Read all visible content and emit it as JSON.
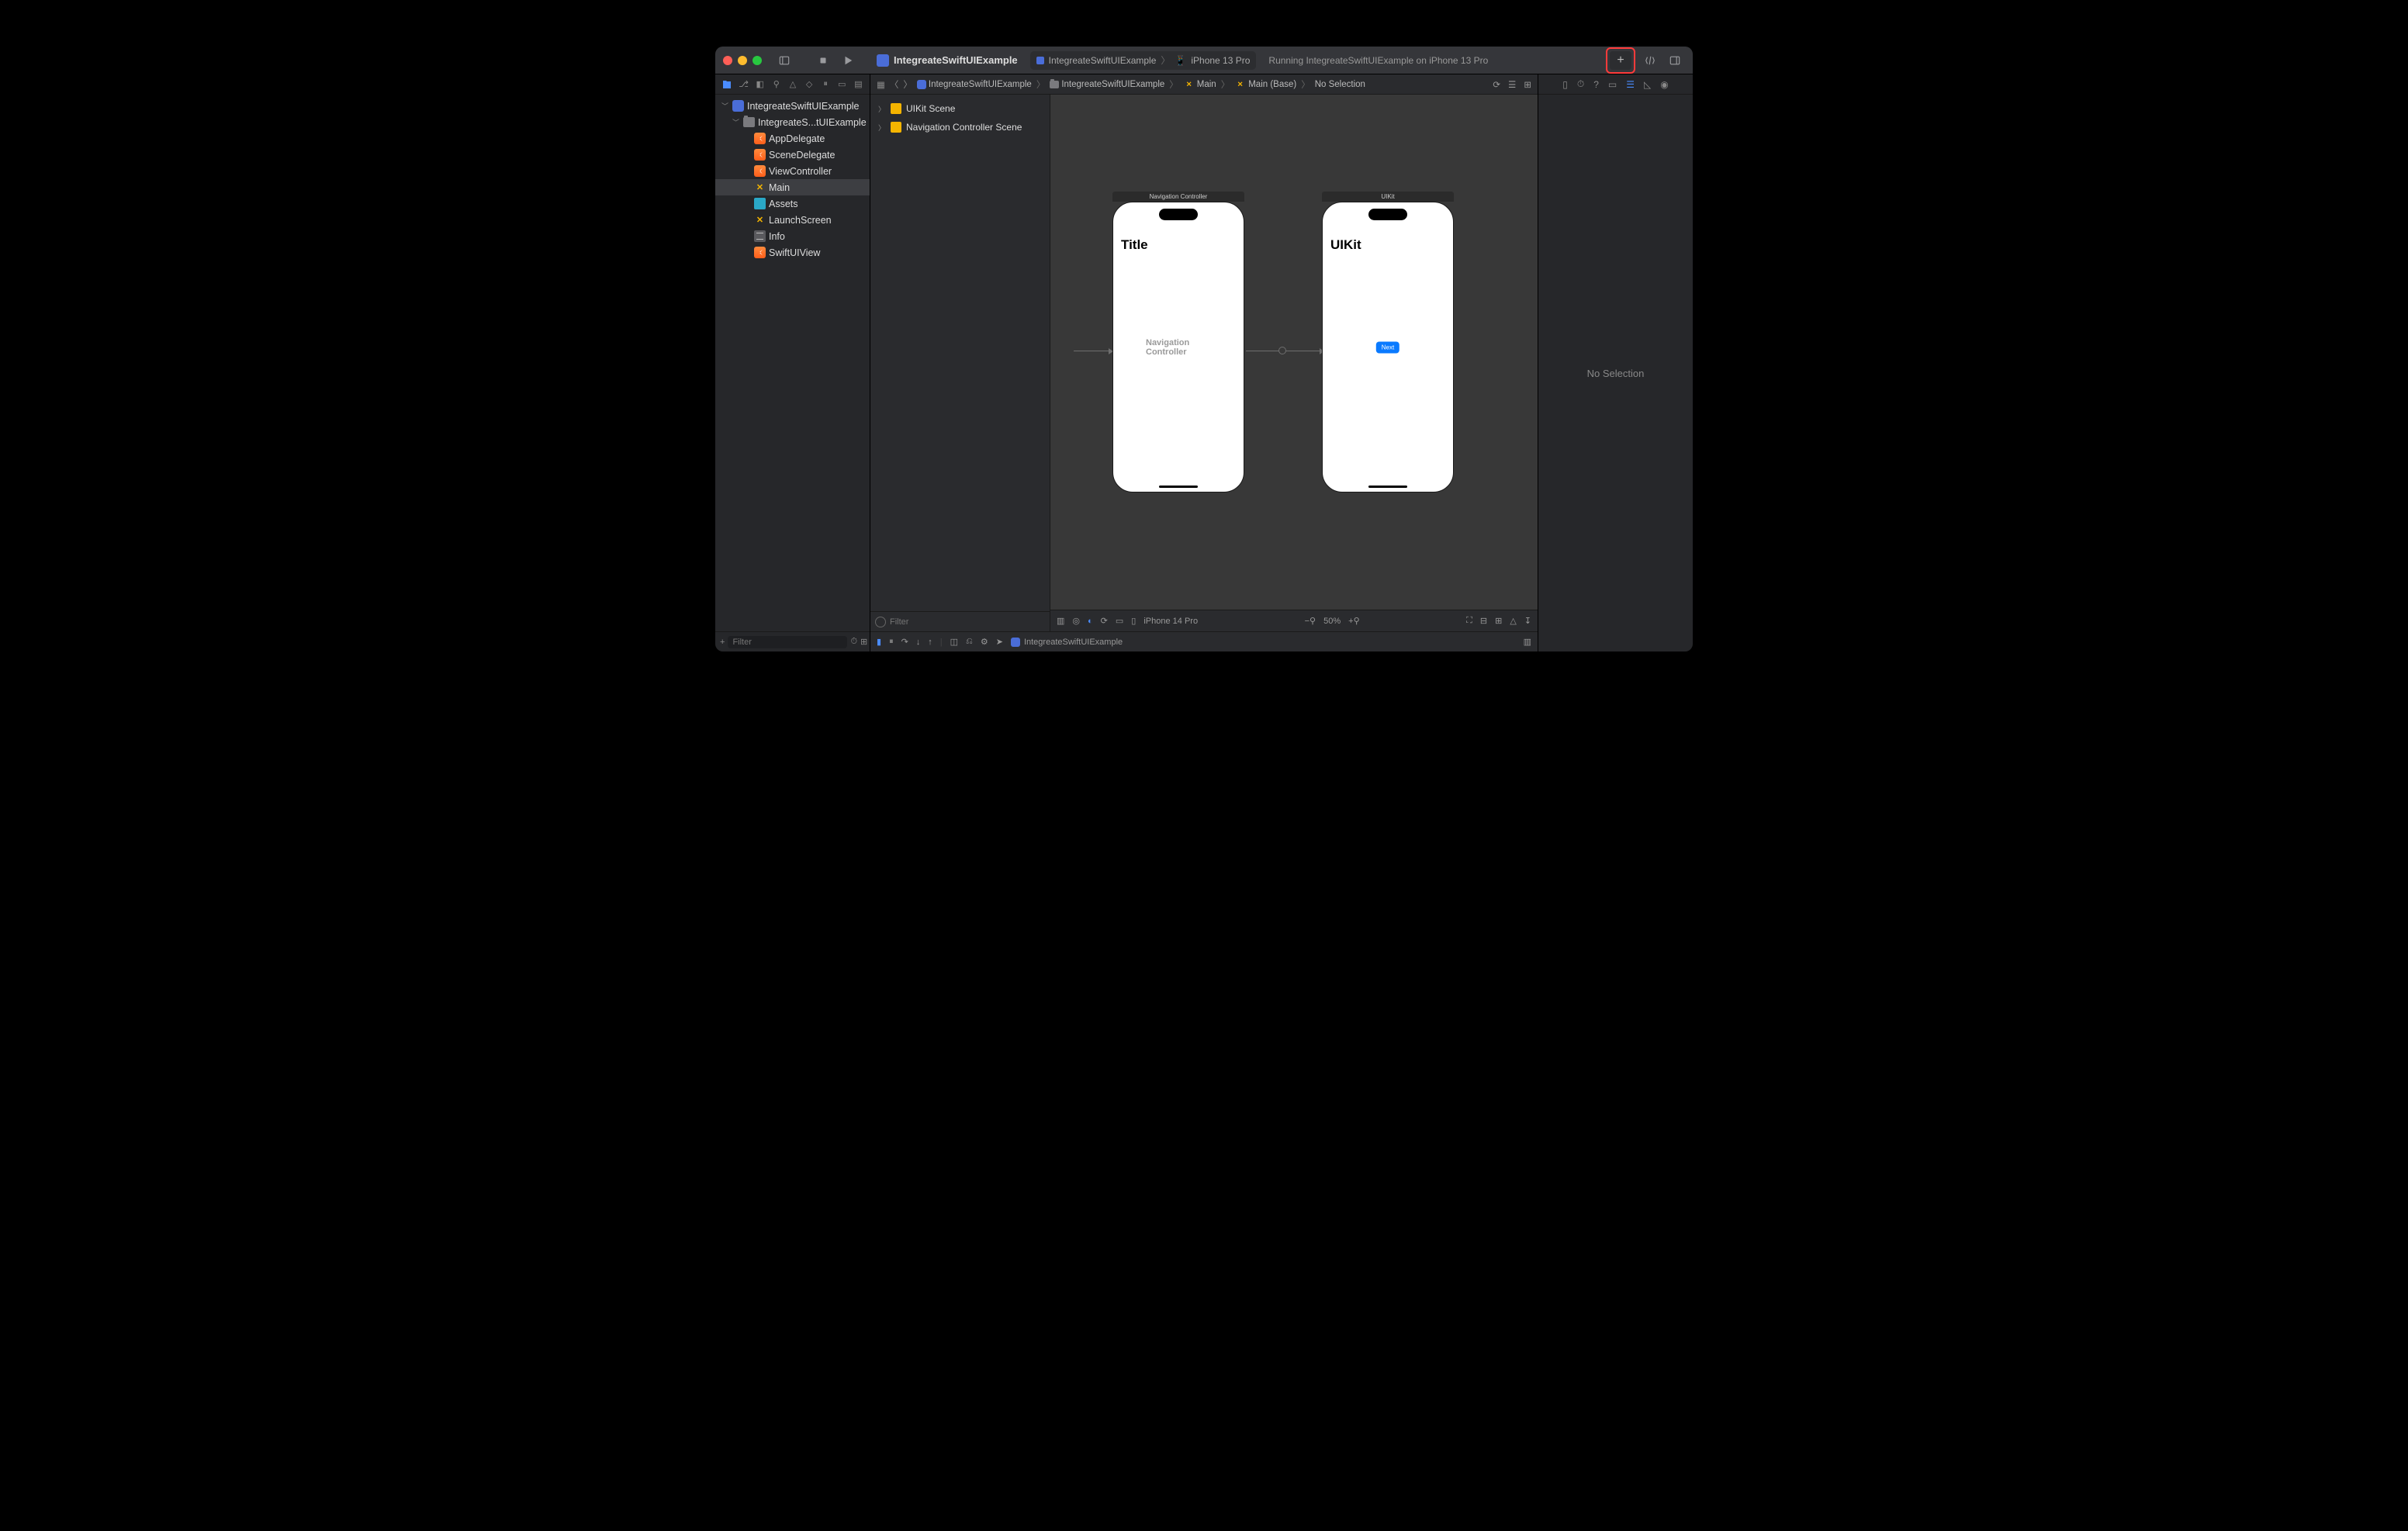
{
  "toolbar": {
    "project_name": "IntegreateSwiftUIExample",
    "scheme": "IntegreateSwiftUIExample",
    "destination": "iPhone 13 Pro",
    "status": "Running IntegreateSwiftUIExample on iPhone 13 Pro"
  },
  "navigator": {
    "filter_placeholder": "Filter",
    "root": "IntegreateSwiftUIExample",
    "group": "IntegreateS...tUIExample",
    "files": {
      "app_delegate": "AppDelegate",
      "scene_delegate": "SceneDelegate",
      "view_controller": "ViewController",
      "main": "Main",
      "assets": "Assets",
      "launch_screen": "LaunchScreen",
      "info": "Info",
      "swiftui_view": "SwiftUIView"
    }
  },
  "jumpbar": {
    "project": "IntegreateSwiftUIExample",
    "group": "IntegreateSwiftUIExample",
    "file": "Main",
    "file_base": "Main (Base)",
    "selection": "No Selection"
  },
  "outline": {
    "filter_placeholder": "Filter",
    "scenes": {
      "uikit": "UIKit Scene",
      "nav": "Navigation Controller Scene"
    }
  },
  "canvas": {
    "scene1_title": "Navigation Controller",
    "scene1_nav_title": "Title",
    "scene1_placeholder": "Navigation Controller",
    "scene2_title": "UIKit",
    "scene2_nav_title": "UIKit",
    "scene2_button": "Next",
    "device": "iPhone 14 Pro",
    "zoom": "50%"
  },
  "debug": {
    "target": "IntegreateSwiftUIExample"
  },
  "inspector": {
    "empty": "No Selection"
  }
}
